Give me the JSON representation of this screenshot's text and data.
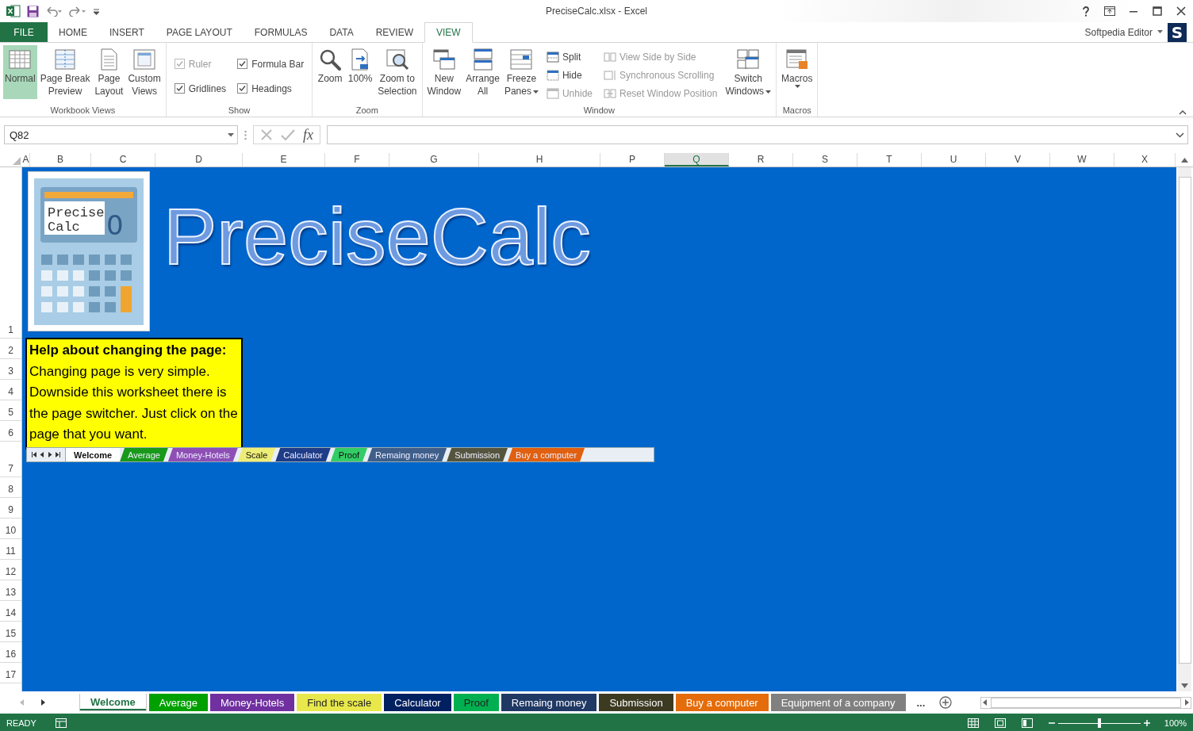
{
  "window": {
    "title": "PreciseCalc.xlsx - Excel",
    "account": "Softpedia Editor",
    "avatar": "S"
  },
  "menu_tabs": [
    {
      "label": "FILE",
      "kind": "file",
      "selected": false
    },
    {
      "label": "HOME",
      "kind": "tab",
      "selected": false
    },
    {
      "label": "INSERT",
      "kind": "tab",
      "selected": false
    },
    {
      "label": "PAGE LAYOUT",
      "kind": "tab",
      "selected": false
    },
    {
      "label": "FORMULAS",
      "kind": "tab",
      "selected": false
    },
    {
      "label": "DATA",
      "kind": "tab",
      "selected": false
    },
    {
      "label": "REVIEW",
      "kind": "tab",
      "selected": false
    },
    {
      "label": "VIEW",
      "kind": "tab",
      "selected": true
    }
  ],
  "ribbon": [
    {
      "label": "Workbook Views",
      "items": [
        {
          "kind": "large",
          "label": "Normal",
          "selected": true
        },
        {
          "kind": "large",
          "label": "Page Break\nPreview",
          "selected": false
        },
        {
          "kind": "large",
          "label": "Page\nLayout",
          "selected": false
        },
        {
          "kind": "large",
          "label": "Custom\nViews",
          "selected": false
        }
      ]
    },
    {
      "label": "Show",
      "items": [
        {
          "kind": "check",
          "label": "Ruler",
          "checked": true,
          "disabled": true
        },
        {
          "kind": "check",
          "label": "Gridlines",
          "checked": true,
          "disabled": false
        },
        {
          "kind": "check",
          "label": "Formula Bar",
          "checked": true,
          "disabled": false
        },
        {
          "kind": "check",
          "label": "Headings",
          "checked": true,
          "disabled": false
        }
      ]
    },
    {
      "label": "Zoom",
      "items": [
        {
          "kind": "large",
          "label": "Zoom",
          "selected": false
        },
        {
          "kind": "large",
          "label": "100%",
          "selected": false
        },
        {
          "kind": "large",
          "label": "Zoom to\nSelection",
          "selected": false
        }
      ]
    },
    {
      "label": "Window",
      "items": [
        {
          "kind": "large",
          "label": "New\nWindow",
          "selected": false
        },
        {
          "kind": "large",
          "label": "Arrange\nAll",
          "selected": false
        },
        {
          "kind": "large",
          "label": "Freeze\nPanes",
          "selected": false,
          "dropdown": true
        },
        {
          "kind": "small",
          "label": "Split",
          "disabled": false
        },
        {
          "kind": "small",
          "label": "Hide",
          "disabled": false
        },
        {
          "kind": "small",
          "label": "Unhide",
          "disabled": true
        },
        {
          "kind": "small",
          "label": "View Side by Side",
          "disabled": true
        },
        {
          "kind": "small",
          "label": "Synchronous Scrolling",
          "disabled": true
        },
        {
          "kind": "small",
          "label": "Reset Window Position",
          "disabled": true
        },
        {
          "kind": "large",
          "label": "Switch\nWindows",
          "selected": false,
          "dropdown": true
        }
      ]
    },
    {
      "label": "Macros",
      "items": [
        {
          "kind": "large",
          "label": "Macros",
          "selected": false,
          "dropdown": true
        }
      ]
    }
  ],
  "name_box": {
    "value": "Q82"
  },
  "formula_bar": {
    "function_label": "fx"
  },
  "columns": [
    {
      "label": "A",
      "selected": false
    },
    {
      "label": "B",
      "selected": false
    },
    {
      "label": "C",
      "selected": false
    },
    {
      "label": "D",
      "selected": false
    },
    {
      "label": "E",
      "selected": false
    },
    {
      "label": "F",
      "selected": false
    },
    {
      "label": "G",
      "selected": false
    },
    {
      "label": "H",
      "selected": false
    },
    {
      "label": "P",
      "selected": false
    },
    {
      "label": "Q",
      "selected": true
    },
    {
      "label": "R",
      "selected": false
    },
    {
      "label": "S",
      "selected": false
    },
    {
      "label": "T",
      "selected": false
    },
    {
      "label": "U",
      "selected": false
    },
    {
      "label": "V",
      "selected": false
    },
    {
      "label": "W",
      "selected": false
    },
    {
      "label": "X",
      "selected": false
    }
  ],
  "rows": [
    "1",
    "2",
    "3",
    "4",
    "5",
    "6",
    "7",
    "8",
    "9",
    "10",
    "11",
    "12",
    "13",
    "14",
    "15",
    "16",
    "17"
  ],
  "sheet": {
    "logo_lines": [
      "Precise",
      "Calc"
    ],
    "logo_digit": "0",
    "title": "PreciseCalc",
    "help_heading": "Help about changing the page:",
    "help_lines": [
      "Changing page is very simple.",
      "Downside this worksheet there is",
      "the page switcher. Just click on the",
      "page that you want."
    ],
    "switcher": [
      {
        "label": "Welcome",
        "color": "#ffffff",
        "selected": true
      },
      {
        "label": "Average",
        "color": "#199919",
        "selected": false
      },
      {
        "label": "Money-Hotels",
        "color": "#8e4fb5",
        "selected": false
      },
      {
        "label": "Scale",
        "color": "#eeee77",
        "selected": false
      },
      {
        "label": "Calculator",
        "color": "#1f3c88",
        "selected": false
      },
      {
        "label": "Proof",
        "color": "#33cc66",
        "selected": false
      },
      {
        "label": "Remaing money",
        "color": "#3f5f8a",
        "selected": false
      },
      {
        "label": "Submission",
        "color": "#55553f",
        "selected": false
      },
      {
        "label": "Buy a computer",
        "color": "#e06010",
        "selected": false
      }
    ]
  },
  "sheet_tabs": [
    {
      "label": "Welcome",
      "color": "#ffffff",
      "selected": true
    },
    {
      "label": "Average",
      "color": "#00a000",
      "selected": false
    },
    {
      "label": "Money-Hotels",
      "color": "#7030a0",
      "selected": false
    },
    {
      "label": "Find the scale",
      "color": "#e8e84c",
      "selected": false
    },
    {
      "label": "Calculator",
      "color": "#002060",
      "selected": false
    },
    {
      "label": "Proof",
      "color": "#00b050",
      "selected": false
    },
    {
      "label": "Remaing money",
      "color": "#1f3864",
      "selected": false
    },
    {
      "label": "Submission",
      "color": "#3d3a22",
      "selected": false
    },
    {
      "label": "Buy a computer",
      "color": "#e46c0a",
      "selected": false
    },
    {
      "label": "Equipment of a company",
      "color": "#808080",
      "selected": false
    }
  ],
  "more_tabs": "...",
  "status": {
    "text": "READY",
    "zoom": {
      "reading": "100%",
      "level": 0.5
    }
  }
}
